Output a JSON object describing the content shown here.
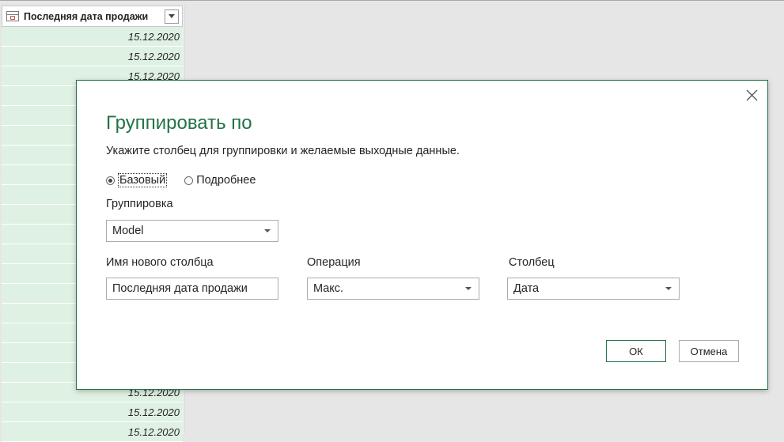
{
  "background_table": {
    "column_header": "Последняя дата продажи",
    "row_value": "15.12.2020",
    "rows": [
      "15.12.2020",
      "15.12.2020",
      "15.12.2020",
      "15.12.2020",
      "15.12.2020",
      "15.12.2020",
      "15.12.2020",
      "15.12.2020",
      "15.12.2020",
      "15.12.2020",
      "15.12.2020",
      "15.12.2020",
      "15.12.2020",
      "15.12.2020",
      "15.12.2020",
      "15.12.2020",
      "15.12.2020",
      "15.12.2020",
      "15.12.2020",
      "15.12.2020",
      "15.12.2020"
    ]
  },
  "dialog": {
    "title": "Группировать по",
    "description": "Укажите столбец для группировки и желаемые выходные данные.",
    "mode_basic": "Базовый",
    "mode_advanced": "Подробнее",
    "mode_selected": "basic",
    "grouping_label": "Группировка",
    "grouping_value": "Model",
    "new_column_label": "Имя нового столбца",
    "new_column_value": "Последняя дата продажи",
    "operation_label": "Операция",
    "operation_value": "Макс.",
    "column_label": "Столбец",
    "column_value": "Дата",
    "ok_label": "ОК",
    "cancel_label": "Отмена"
  },
  "colors": {
    "accent": "#217346",
    "row_fill": "#dff1e3",
    "background": "#e6e6e6"
  },
  "icons": {
    "close": "close-icon",
    "dropdown": "chevron-down-icon",
    "column_type": "date-type-icon",
    "filter": "filter-dropdown-icon"
  }
}
